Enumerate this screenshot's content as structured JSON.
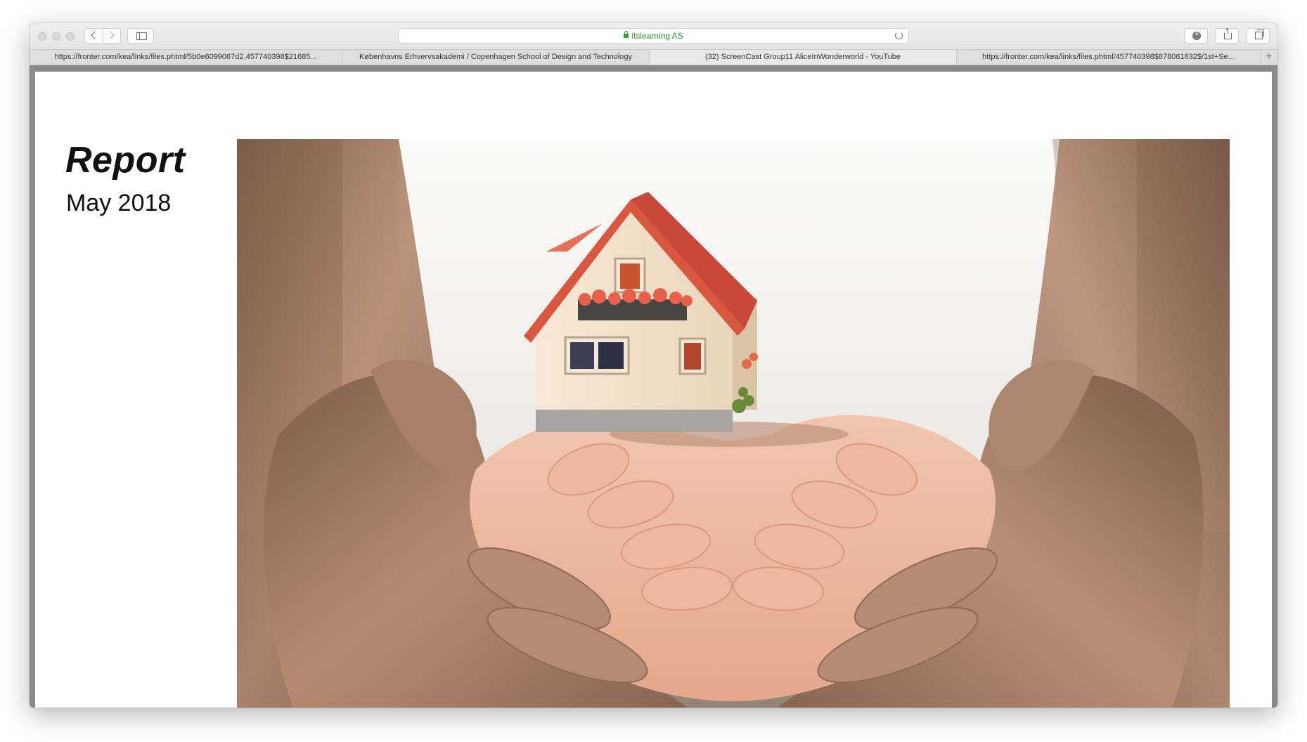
{
  "browser": {
    "address": "itslearning AS",
    "tabs": [
      "https://fronter.com/kea/links/files.phtml/5b0e6099067d2.457740398$21685...",
      "Københavns Erhvervsakademi / Copenhagen School of Design and Technology",
      "(32) ScreenCast Group11 AliceInWonderworld - YouTube",
      "https://fronter.com/kea/links/files.phtml/457740398$878061632$/1st+Se..."
    ],
    "new_tab": "+",
    "icons": {
      "back": "chevron-left-icon",
      "forward": "chevron-right-icon",
      "sidebar": "sidebar-icon",
      "lock": "lock-icon",
      "reload": "reload-icon",
      "download": "download-icon",
      "share": "share-icon",
      "tabs": "tabs-overview-icon"
    },
    "colors": {
      "secure": "#2b9e2b",
      "chrome": "#e8e8e8"
    }
  },
  "page": {
    "title": "Report",
    "subtitle": "May 2018",
    "hero_image": "hands-holding-model-house"
  }
}
